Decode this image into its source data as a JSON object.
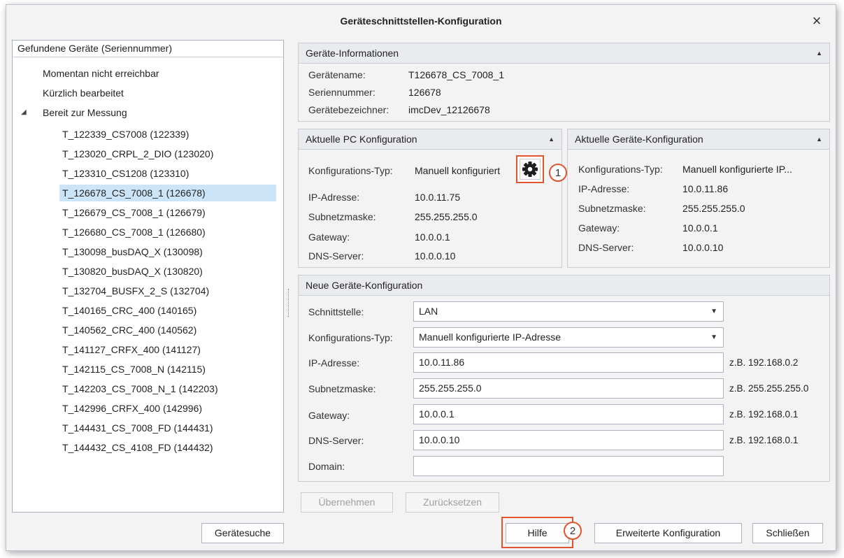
{
  "window": {
    "title": "Geräteschnittstellen-Konfiguration",
    "close_glyph": "×"
  },
  "tree": {
    "header": "Gefundene Geräte (Seriennummer)",
    "groups": [
      "Momentan nicht erreichbar",
      "Kürzlich bearbeitet",
      "Bereit zur Messung"
    ],
    "expanded_glyph": "◢",
    "devices": [
      "T_122339_CS7008 (122339)",
      "T_123020_CRPL_2_DIO (123020)",
      "T_123310_CS1208 (123310)",
      "T_126678_CS_7008_1 (126678)",
      "T_126679_CS_7008_1 (126679)",
      "T_126680_CS_7008_1 (126680)",
      "T_130098_busDAQ_X (130098)",
      "T_130820_busDAQ_X (130820)",
      "T_132704_BUSFX_2_S (132704)",
      "T_140165_CRC_400 (140165)",
      "T_140562_CRC_400 (140562)",
      "T_141127_CRFX_400 (141127)",
      "T_142115_CS_7008_N (142115)",
      "T_142203_CS_7008_N_1 (142203)",
      "T_142996_CRFX_400 (142996)",
      "T_144431_CS_7008_FD (144431)",
      "T_144432_CS_4108_FD (144432)"
    ],
    "selected_index": 3
  },
  "device_info": {
    "header": "Geräte-Informationen",
    "name_label": "Gerätename:",
    "name_value": "T126678_CS_7008_1",
    "serial_label": "Seriennummer:",
    "serial_value": "126678",
    "id_label": "Gerätebezeichner:",
    "id_value": "imcDev_12126678"
  },
  "pc_config": {
    "header": "Aktuelle PC Konfiguration",
    "type_label": "Konfigurations-Typ:",
    "type_value": "Manuell konfiguriert",
    "ip_label": "IP-Adresse:",
    "ip_value": "10.0.11.75",
    "mask_label": "Subnetzmaske:",
    "mask_value": "255.255.255.0",
    "gw_label": "Gateway:",
    "gw_value": "10.0.0.1",
    "dns_label": "DNS-Server:",
    "dns_value": "10.0.0.10"
  },
  "device_config": {
    "header": "Aktuelle Geräte-Konfiguration",
    "type_label": "Konfigurations-Typ:",
    "type_value": "Manuell konfigurierte IP...",
    "ip_label": "IP-Adresse:",
    "ip_value": "10.0.11.86",
    "mask_label": "Subnetzmaske:",
    "mask_value": "255.255.255.0",
    "gw_label": "Gateway:",
    "gw_value": "10.0.0.1",
    "dns_label": "DNS-Server:",
    "dns_value": "10.0.0.10"
  },
  "new_config": {
    "header": "Neue Geräte-Konfiguration",
    "interface_label": "Schnittstelle:",
    "interface_value": "LAN",
    "type_label": "Konfigurations-Typ:",
    "type_value": "Manuell konfigurierte IP-Adresse",
    "ip_label": "IP-Adresse:",
    "ip_value": "10.0.11.86",
    "ip_hint": "z.B. 192.168.0.2",
    "mask_label": "Subnetzmaske:",
    "mask_value": "255.255.255.0",
    "mask_hint": "z.B. 255.255.255.0",
    "gw_label": "Gateway:",
    "gw_value": "10.0.0.1",
    "gw_hint": "z.B. 192.168.0.1",
    "dns_label": "DNS-Server:",
    "dns_value": "10.0.0.10",
    "dns_hint": "z.B. 192.168.0.1",
    "domain_label": "Domain:",
    "domain_value": ""
  },
  "buttons": {
    "apply": "Übernehmen",
    "reset": "Zurücksetzen",
    "search": "Gerätesuche",
    "help": "Hilfe",
    "advanced": "Erweiterte Konfiguration",
    "close": "Schließen"
  },
  "callouts": [
    "1",
    "2"
  ],
  "colors": {
    "accent": "#e0542f",
    "selection": "#cce4f7",
    "panel_header": "#e9ebee"
  },
  "icons": {
    "collapse": "chevron-up-icon",
    "dropdown": "chevron-down-icon",
    "gear": "gear-icon",
    "close": "close-icon"
  }
}
